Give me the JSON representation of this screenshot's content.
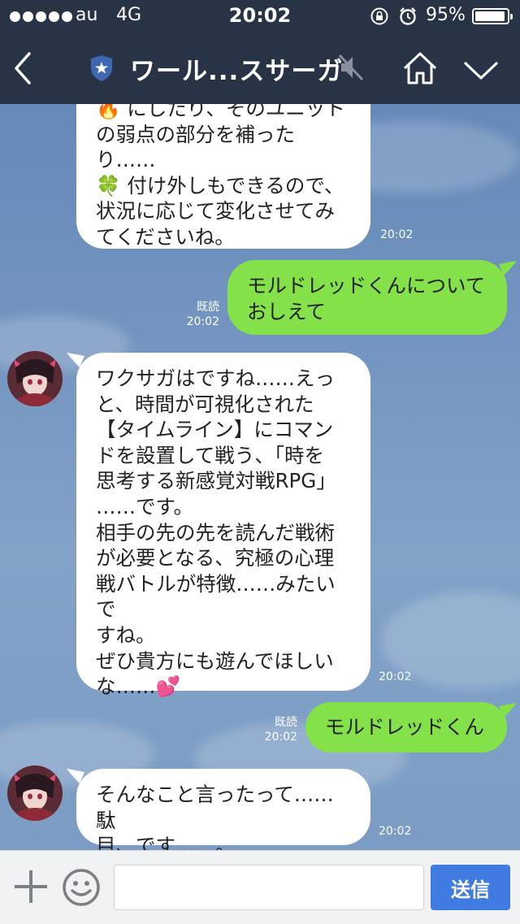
{
  "status": {
    "carrier": "au",
    "network": "4G",
    "time": "20:02",
    "battery": "95%",
    "battery_level": 0.95
  },
  "nav": {
    "title": "ワール...スサーガ"
  },
  "messages": [
    {
      "side": "left",
      "text": "🔥 にしたり、そのユニット\nの弱点の部分を補ったり……\n🍀 付け外しもできるので、\n状況に応じて変化させてみ\nてくださいね。",
      "time": "20:02"
    },
    {
      "side": "right",
      "text": "モルドレッドくんについて\nおしえて",
      "read": "既読",
      "time": "20:02"
    },
    {
      "side": "left",
      "text": "ワクサガはですね……えっ\nと、時間が可視化された\n【タイムライン】にコマン\nドを設置して戦う、「時を\n思考する新感覚対戦RPG」\n……です。\n相手の先の先を読んだ戦術\nが必要となる、究極の心理\n戦バトルが特徴……みたいで\nすね。\nぜひ貴方にも遊んでほしい\nな……💕",
      "time": "20:02"
    },
    {
      "side": "right",
      "text": "モルドレッドくん",
      "read": "既読",
      "time": "20:02"
    },
    {
      "side": "left",
      "text": "そんなこと言ったって……駄\n目、です……。",
      "time": "20:02"
    }
  ],
  "input": {
    "placeholder": "",
    "send_label": "送信"
  },
  "colors": {
    "header": "#283346",
    "my_bubble": "#84e14a",
    "send_button": "#3f7be0"
  }
}
